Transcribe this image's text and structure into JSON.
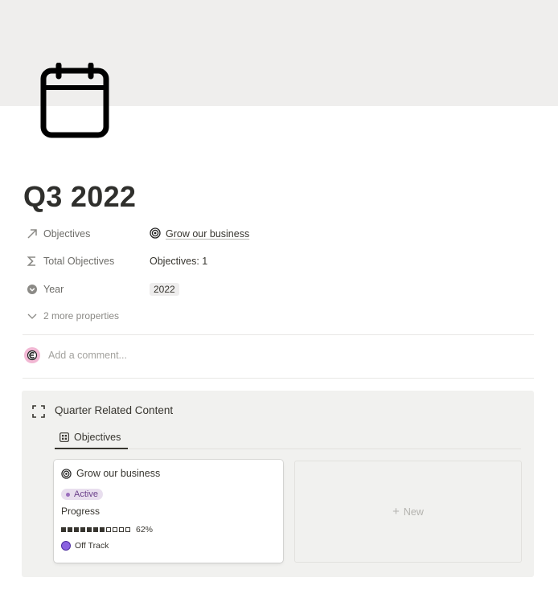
{
  "page": {
    "title": "Q3 2022",
    "icon": "calendar-icon"
  },
  "properties": [
    {
      "name": "Objectives",
      "icon": "arrow-up-right-icon",
      "value": "Grow our business",
      "value_icon": "target-icon"
    },
    {
      "name": "Total Objectives",
      "icon": "sigma-icon",
      "value": "Objectives: 1"
    },
    {
      "name": "Year",
      "icon": "select-icon",
      "value": "2022"
    }
  ],
  "more_properties": "2 more properties",
  "comment": {
    "placeholder": "Add a comment..."
  },
  "callout": {
    "icon": "expand-icon",
    "title": "Quarter Related Content",
    "tabs": [
      {
        "label": "Objectives",
        "icon": "gallery-icon"
      }
    ],
    "cards": [
      {
        "title": "Grow our business",
        "icon": "target-icon",
        "status": "Active",
        "progress_label": "Progress",
        "progress_percent": "62%",
        "progress_filled": 7,
        "progress_total": 11,
        "track": "Off Track"
      }
    ],
    "new_label": "New"
  },
  "colors": {
    "cover": "#efeeed",
    "callout_bg": "#f1f1ef",
    "status_pill_bg": "#e8deee",
    "status_text": "#6b3f8a",
    "track_dot": "#8a63e0"
  }
}
